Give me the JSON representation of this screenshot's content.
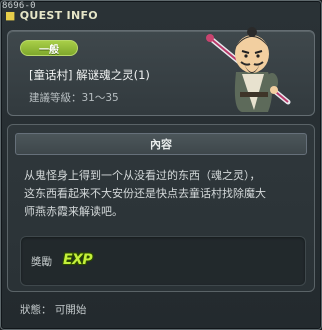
{
  "window": {
    "quest_id": "8696-0",
    "title": "QUEST INFO"
  },
  "quest": {
    "category": "一般",
    "name": "[童话村] 解谜魂之灵(1)",
    "level_requirement": "建議等級：31～35"
  },
  "content": {
    "header": "內容",
    "description": "从鬼怪身上得到一个从没看过的东西（魂之灵），\n这东西看起来不大安份还是快点去童话村找除魔大\n师燕赤霞来解读吧。"
  },
  "reward": {
    "label": "獎勵",
    "exp_label": "EXP"
  },
  "status": {
    "text": "狀態： 可開始"
  },
  "colors": {
    "category_badge": "#8fb838",
    "exp_text": "#c4f03a",
    "title_dot": "#e7ce4a"
  }
}
